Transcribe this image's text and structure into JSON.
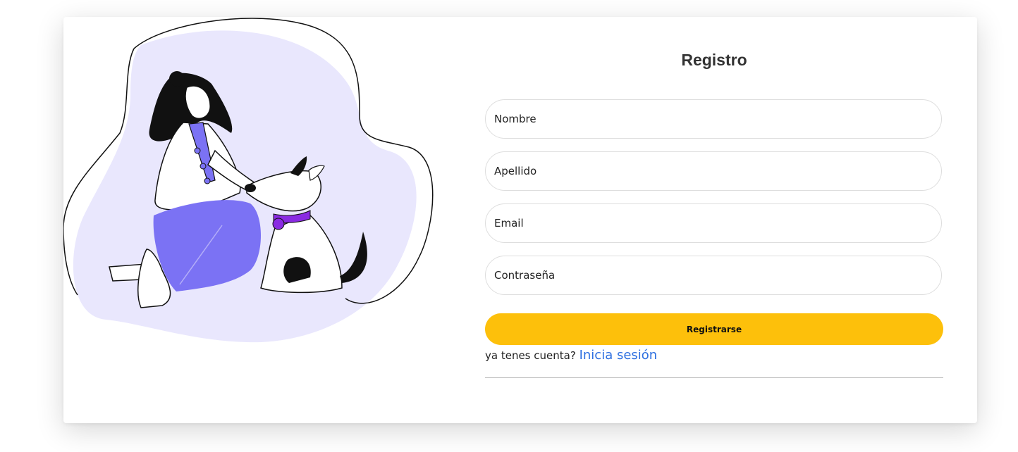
{
  "form": {
    "title": "Registro",
    "fields": [
      {
        "name": "nombre",
        "placeholder": "Nombre",
        "value": ""
      },
      {
        "name": "apellido",
        "placeholder": "Apellido",
        "value": ""
      },
      {
        "name": "email",
        "placeholder": "Email",
        "value": ""
      },
      {
        "name": "password",
        "placeholder": "Contraseña",
        "value": ""
      }
    ],
    "submit_label": "Registrarse",
    "login_prompt": "ya tenes cuenta?",
    "login_link": "Inicia sesión"
  },
  "colors": {
    "accent": "#fdc00b",
    "link": "#2d6fe0",
    "illustration_bg": "#e9e7fd",
    "illustration_purple": "#7b72f4",
    "collar": "#8a2be2"
  }
}
